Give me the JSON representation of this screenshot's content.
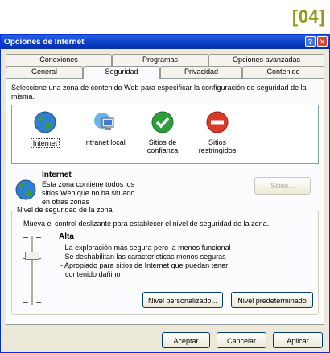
{
  "corner_label": "[04]",
  "window": {
    "title": "Opciones de Internet"
  },
  "title_buttons": {
    "help": "?",
    "close": "✕"
  },
  "tabs_back": [
    "Conexiones",
    "Programas",
    "Opciones avanzadas"
  ],
  "tabs_front": [
    "General",
    "Seguridad",
    "Privacidad",
    "Contenido"
  ],
  "active_tab": "Seguridad",
  "intro": "Seleccione una zona de contenido Web para especificar la configuración de seguridad de la misma.",
  "zones": [
    {
      "label": "Internet",
      "icon": "globe-icon",
      "selected": true
    },
    {
      "label": "Intranet local",
      "icon": "network-computer-icon",
      "selected": false
    },
    {
      "label": "Sitios de confianza",
      "icon": "checkmark-icon",
      "selected": false
    },
    {
      "label": "Sitios restringidos",
      "icon": "no-entry-icon",
      "selected": false
    }
  ],
  "zone_info": {
    "title": "Internet",
    "description": "Esta zona contiene todos los sitios Web que no ha situado en otras zonas",
    "sites_button": "Sitios..."
  },
  "security_level": {
    "legend": "Nivel de seguridad de la zona",
    "instruction": "Mueva el control deslizante para establecer el nivel de seguridad de la zona.",
    "level": "Alta",
    "bullets": [
      "- La exploración más segura pero la menos funcional",
      "- Se deshabilitan las características menos seguras",
      "- Apropiado para sitios de Internet que puedan tener",
      "  contenido dañino"
    ],
    "custom_button": "Nivel personalizado...",
    "default_button": "Nivel predeterminado"
  },
  "footer": {
    "ok": "Aceptar",
    "cancel": "Cancelar",
    "apply": "Aplicar"
  },
  "colors": {
    "titlebar": "#0b3fc8",
    "dialog_bg": "#ece9d8",
    "accent_label": "#8f9c1b"
  }
}
